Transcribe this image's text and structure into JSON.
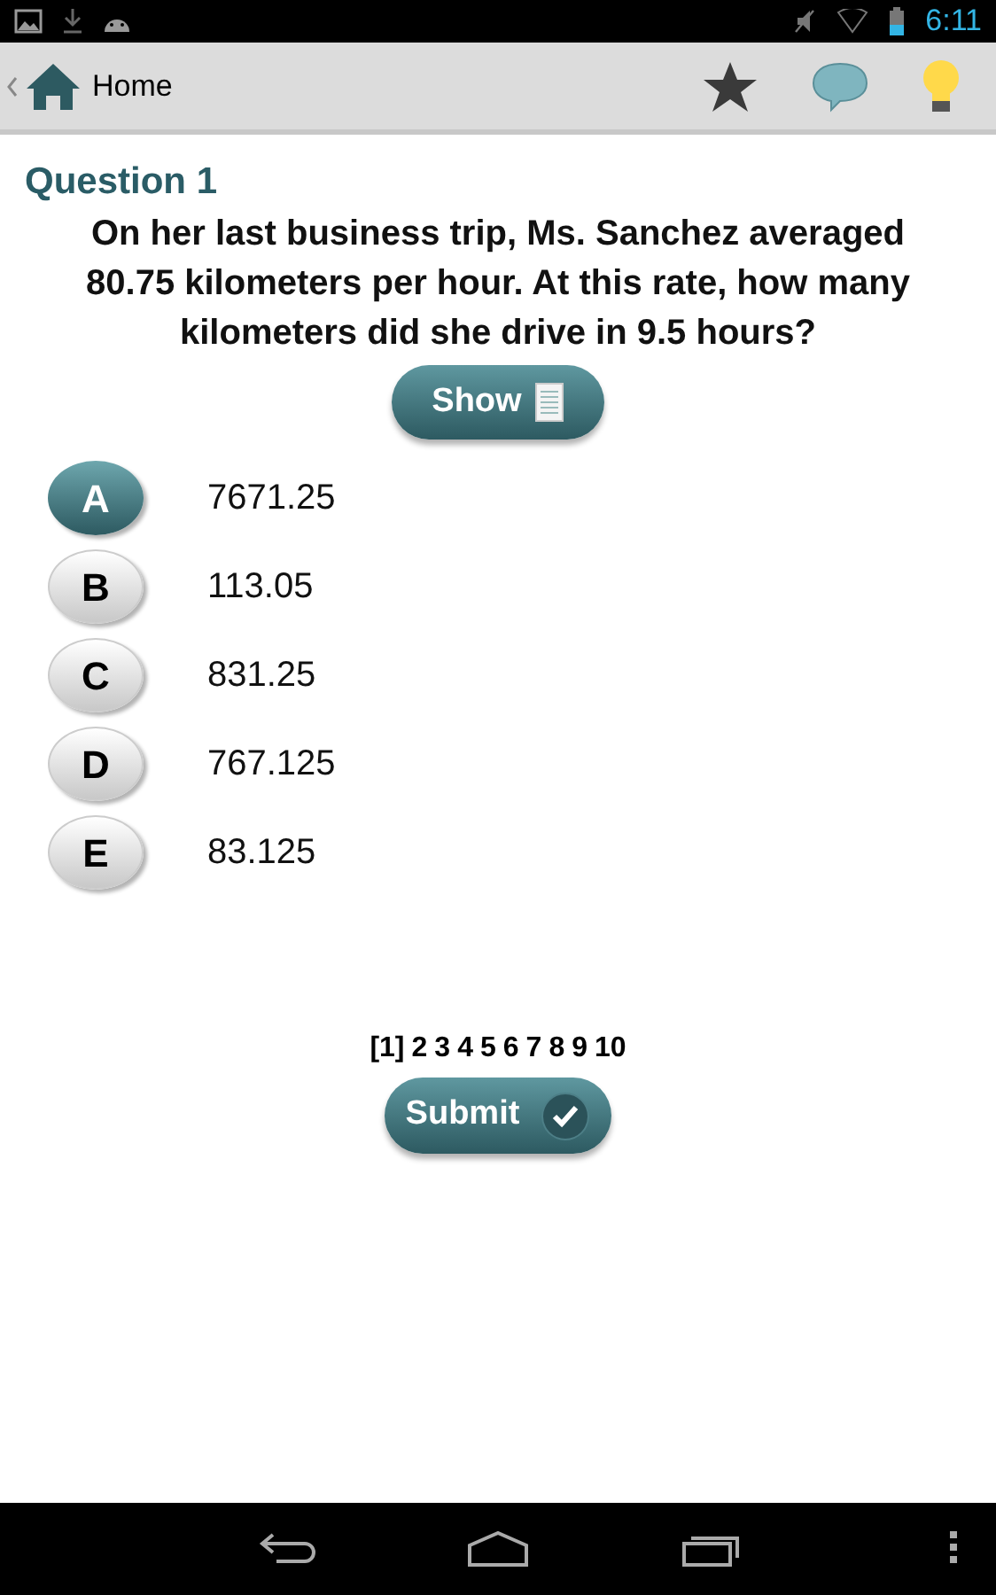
{
  "status_bar": {
    "time": "6:11"
  },
  "action_bar": {
    "title": "Home"
  },
  "question": {
    "title": "Question 1",
    "text": "On her last business trip, Ms. Sanchez averaged 80.75 kilometers per hour. At this rate, how many kilometers did she drive in 9.5 hours?"
  },
  "show_button": {
    "label": "Show"
  },
  "options": [
    {
      "letter": "A",
      "answer": "7671.25",
      "selected": true
    },
    {
      "letter": "B",
      "answer": "113.05",
      "selected": false
    },
    {
      "letter": "C",
      "answer": "831.25",
      "selected": false
    },
    {
      "letter": "D",
      "answer": "767.125",
      "selected": false
    },
    {
      "letter": "E",
      "answer": "83.125",
      "selected": false
    }
  ],
  "pages": [
    "[1]",
    "2",
    "3",
    "4",
    "5",
    "6",
    "7",
    "8",
    "9",
    "10"
  ],
  "submit_button": {
    "label": "Submit"
  }
}
